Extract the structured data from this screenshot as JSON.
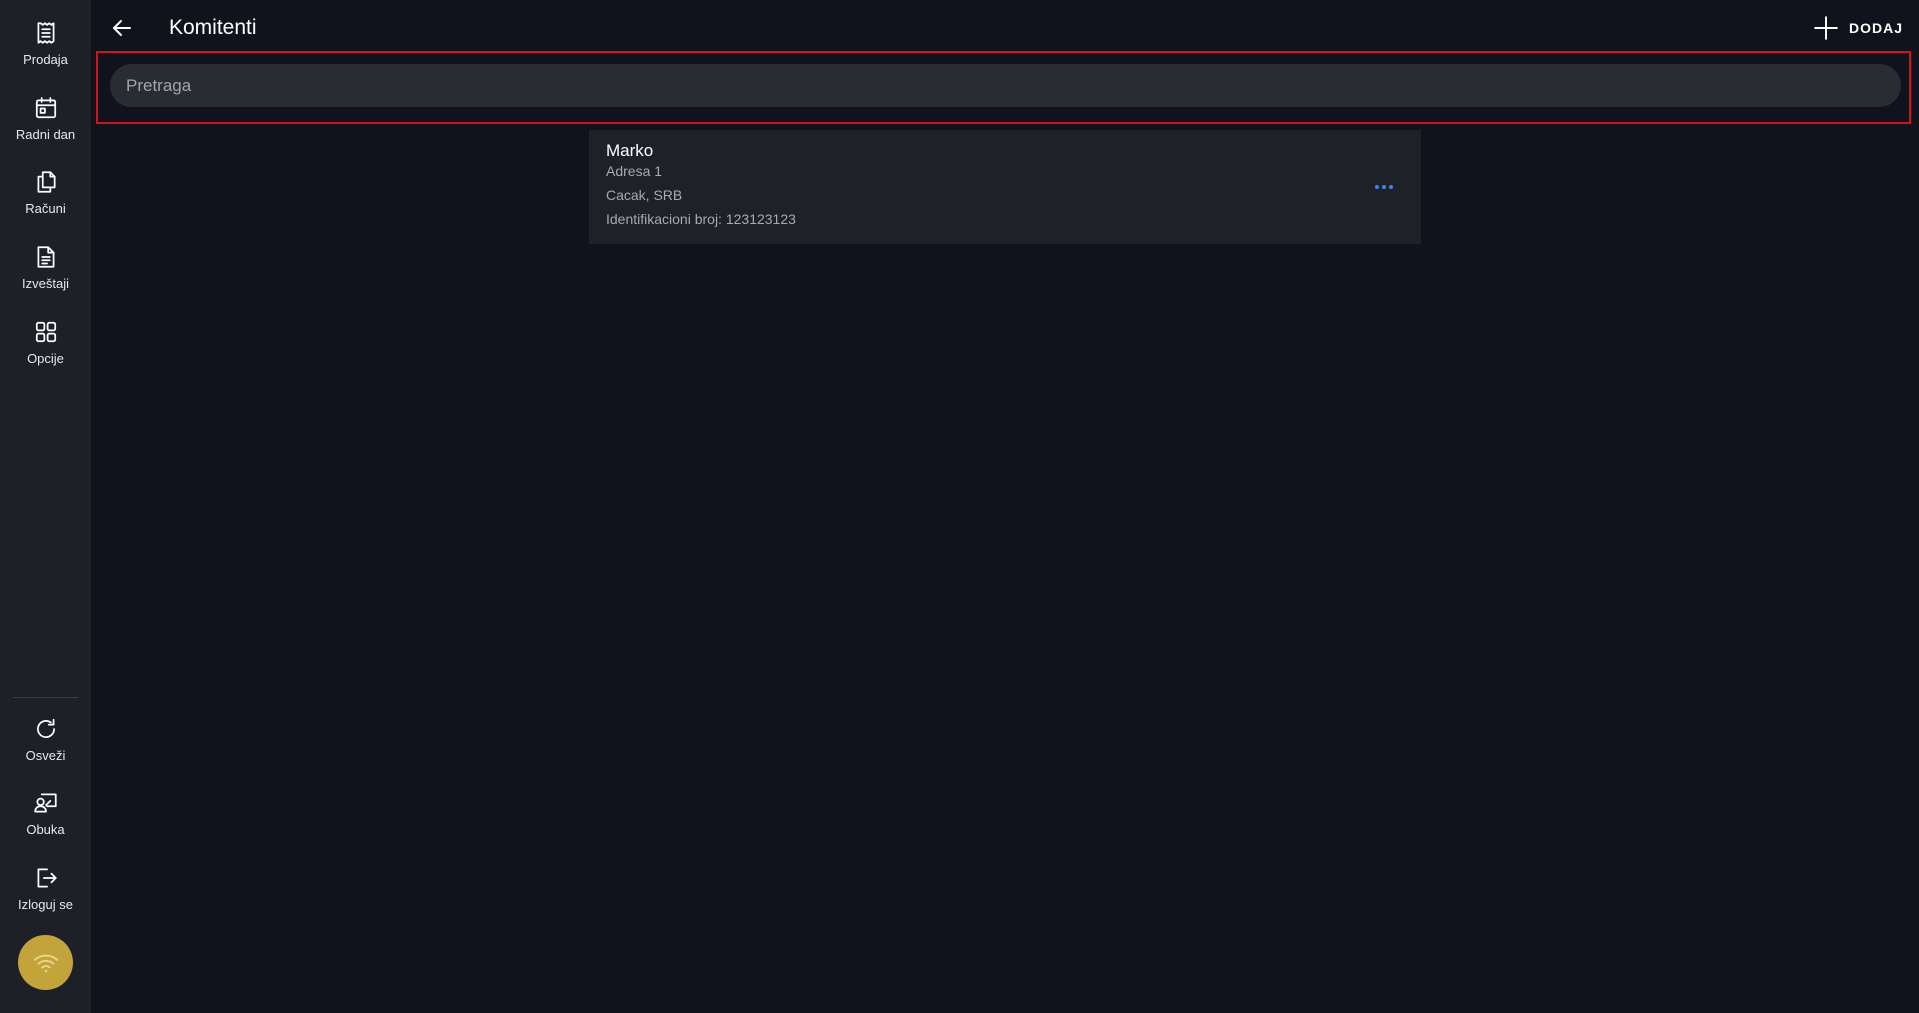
{
  "sidebar": {
    "items": [
      {
        "label": "Prodaja",
        "icon": "receipt-icon"
      },
      {
        "label": "Radni dan",
        "icon": "calendar-icon"
      },
      {
        "label": "Računi",
        "icon": "documents-icon"
      },
      {
        "label": "Izveštaji",
        "icon": "report-icon"
      },
      {
        "label": "Opcije",
        "icon": "grid-icon"
      }
    ],
    "bottom_items": [
      {
        "label": "Osveži",
        "icon": "refresh-icon"
      },
      {
        "label": "Obuka",
        "icon": "training-icon"
      },
      {
        "label": "Izloguj se",
        "icon": "logout-icon"
      }
    ],
    "status_icon": "wifi-icon",
    "status_color": "#c2a43a"
  },
  "header": {
    "title": "Komitenti",
    "back_icon": "arrow-left-icon",
    "add_label": "DODAJ",
    "add_icon": "plus-icon"
  },
  "search": {
    "placeholder": "Pretraga",
    "value": "",
    "highlight_color": "#d6101c"
  },
  "clients": [
    {
      "name": "Marko",
      "address": "Adresa 1",
      "city": "Cacak, SRB",
      "id_line": "Identifikacioni broj: 123123123",
      "menu_icon": "more-horizontal-icon"
    }
  ],
  "colors": {
    "background": "#10131b",
    "sidebar": "#1e2028",
    "card": "#1f2129",
    "accent": "#3b82f6"
  }
}
